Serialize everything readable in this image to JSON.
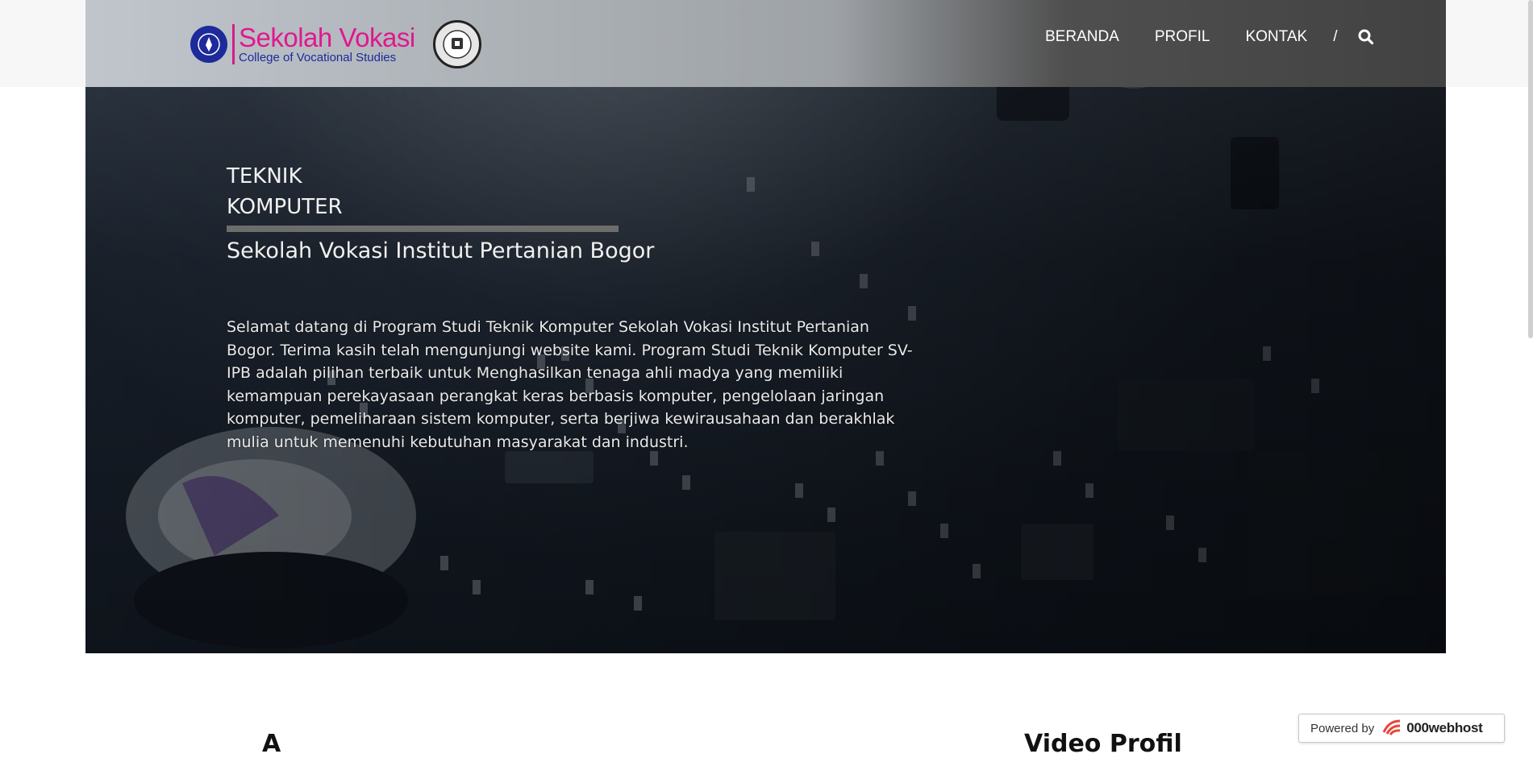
{
  "header": {
    "logo_title": "Sekolah Vokasi",
    "logo_subtitle": "College of Vocational Studies",
    "nav": [
      {
        "label": "BERANDA"
      },
      {
        "label": "PROFIL"
      },
      {
        "label": "KONTAK"
      }
    ],
    "separator": "/",
    "icons": {
      "search": "search-icon"
    }
  },
  "hero": {
    "title_line1": "TEKNIK",
    "title_line2": "KOMPUTER",
    "subtitle": "Sekolah Vokasi Institut Pertanian Bogor",
    "description": "Selamat datang di Program Studi Teknik Komputer Sekolah Vokasi Institut Pertanian Bogor. Terima kasih telah mengunjungi website kami. Program Studi Teknik Komputer SV-IPB adalah pilihan terbaik untuk Menghasilkan tenaga ahli madya yang memiliki kemampuan perekayasaan perangkat keras berbasis komputer, pengelolaan jaringan komputer, pemeliharaan sistem komputer, serta berjiwa kewirausahaan dan berakhlak mulia untuk memenuhi kebutuhan masyarakat dan industri."
  },
  "sections": {
    "left_heading": "A",
    "right_heading": "Video Profil"
  },
  "badge": {
    "powered_label": "Powered by",
    "brand": "000webhost"
  },
  "colors": {
    "brand_pink": "#e0188f",
    "brand_blue": "#1d2a9b",
    "nav_text": "#ffffff"
  }
}
